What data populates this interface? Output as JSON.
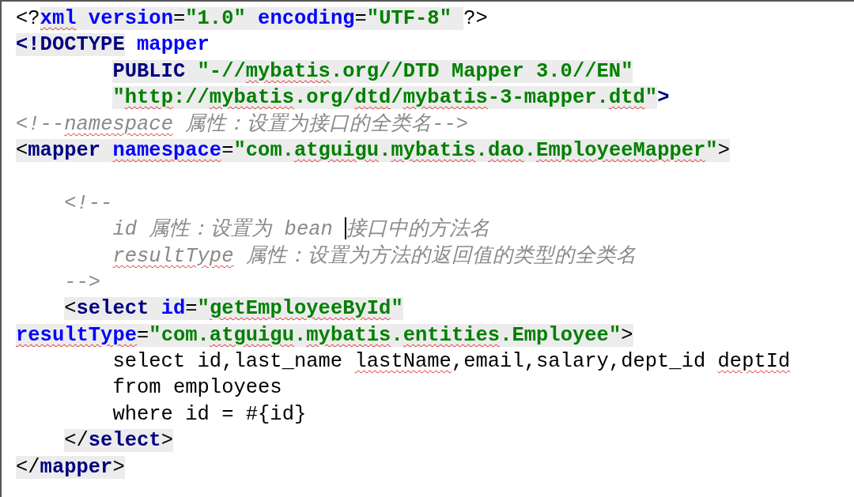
{
  "code_lines": [
    {
      "indented": false,
      "deep": false,
      "space_before": false,
      "tokens": [
        {
          "kind": "punct",
          "text": "<?",
          "shaded": false
        },
        {
          "kind": "attr",
          "text": "xml",
          "shaded": true,
          "misspelled": true
        },
        {
          "kind": "attr",
          "text": " version",
          "shaded": true
        },
        {
          "kind": "punct",
          "text": "=",
          "shaded": true
        },
        {
          "kind": "value",
          "text": "\"1.0\" ",
          "shaded": true
        },
        {
          "kind": "attr",
          "text": "encoding",
          "shaded": true
        },
        {
          "kind": "punct",
          "text": "=",
          "shaded": true
        },
        {
          "kind": "value",
          "text": "\"UTF-8\" ",
          "shaded": true
        },
        {
          "kind": "punct",
          "text": "?>",
          "shaded": false
        }
      ]
    },
    {
      "indented": false,
      "deep": false,
      "space_before": false,
      "tokens": [
        {
          "kind": "keyword",
          "text": "<!DOCTYPE",
          "shaded": true
        },
        {
          "kind": "attr",
          "text": " mapper",
          "shaded": false
        }
      ]
    },
    {
      "indented": true,
      "deep": true,
      "space_before": false,
      "tokens": [
        {
          "kind": "keyword",
          "text": "PUBLIC ",
          "shaded": true
        },
        {
          "kind": "value",
          "text": "\"-//",
          "shaded": true
        },
        {
          "kind": "value",
          "text": "mybatis",
          "shaded": true,
          "misspelled": true
        },
        {
          "kind": "value",
          "text": ".org//DTD Mapper 3.0//EN\"",
          "shaded": true
        }
      ]
    },
    {
      "indented": true,
      "deep": true,
      "space_before": false,
      "tokens": [
        {
          "kind": "value",
          "text": "\"",
          "shaded": true
        },
        {
          "kind": "value",
          "text": "http",
          "shaded": true,
          "misspelled": true
        },
        {
          "kind": "value",
          "text": "://",
          "shaded": true
        },
        {
          "kind": "value",
          "text": "mybatis",
          "shaded": true,
          "misspelled": true
        },
        {
          "kind": "value",
          "text": ".org/",
          "shaded": true
        },
        {
          "kind": "value",
          "text": "dtd",
          "shaded": true,
          "misspelled": true
        },
        {
          "kind": "value",
          "text": "/",
          "shaded": true
        },
        {
          "kind": "value",
          "text": "mybatis",
          "shaded": true,
          "misspelled": true
        },
        {
          "kind": "value",
          "text": "-3-mapper.",
          "shaded": true
        },
        {
          "kind": "value",
          "text": "dtd",
          "shaded": true,
          "misspelled": true
        },
        {
          "kind": "value",
          "text": "\"",
          "shaded": true
        },
        {
          "kind": "keyword",
          "text": ">",
          "shaded": false
        }
      ]
    },
    {
      "indented": false,
      "deep": false,
      "space_before": false,
      "tokens": [
        {
          "kind": "comment",
          "text": "<!--",
          "shaded": false
        },
        {
          "kind": "comment",
          "text": "namespace",
          "shaded": false,
          "misspelled": true
        },
        {
          "kind": "comment",
          "text": " 属性：设置为接口的全类名-->",
          "shaded": false
        }
      ]
    },
    {
      "indented": false,
      "deep": false,
      "space_before": false,
      "tokens": [
        {
          "kind": "punct",
          "text": "<",
          "shaded": true
        },
        {
          "kind": "keyword",
          "text": "mapper ",
          "shaded": true
        },
        {
          "kind": "attr",
          "text": "namespace",
          "shaded": true,
          "misspelled": true
        },
        {
          "kind": "punct",
          "text": "=",
          "shaded": true
        },
        {
          "kind": "value",
          "text": "\"com.",
          "shaded": true
        },
        {
          "kind": "value",
          "text": "atguigu",
          "shaded": true,
          "misspelled": true
        },
        {
          "kind": "value",
          "text": ".",
          "shaded": true
        },
        {
          "kind": "value",
          "text": "mybatis",
          "shaded": true,
          "misspelled": true
        },
        {
          "kind": "value",
          "text": ".",
          "shaded": true
        },
        {
          "kind": "value",
          "text": "dao",
          "shaded": true,
          "misspelled": true
        },
        {
          "kind": "value",
          "text": ".",
          "shaded": true
        },
        {
          "kind": "value",
          "text": "EmployeeMapper",
          "shaded": true,
          "misspelled": true
        },
        {
          "kind": "value",
          "text": "\"",
          "shaded": true
        },
        {
          "kind": "punct",
          "text": ">",
          "shaded": true
        }
      ]
    },
    {
      "indented": true,
      "deep": false,
      "space_before": true,
      "tokens": [
        {
          "kind": "comment",
          "text": "<!--",
          "shaded": false
        }
      ]
    },
    {
      "indented": true,
      "deep": true,
      "space_before": false,
      "tokens": [
        {
          "kind": "comment",
          "text": "id 属性：设置为 bean ",
          "shaded": false
        },
        {
          "kind": "caret"
        },
        {
          "kind": "comment",
          "text": "接口中的方法名",
          "shaded": false
        }
      ]
    },
    {
      "indented": true,
      "deep": true,
      "space_before": false,
      "tokens": [
        {
          "kind": "comment",
          "text": "resultType",
          "shaded": false,
          "misspelled": true
        },
        {
          "kind": "comment",
          "text": " 属性：设置为方法的返回值的类型的全类名",
          "shaded": false
        }
      ]
    },
    {
      "indented": true,
      "deep": false,
      "space_before": false,
      "tokens": [
        {
          "kind": "comment",
          "text": "-->",
          "shaded": false
        }
      ]
    },
    {
      "indented": true,
      "deep": false,
      "space_before": false,
      "tokens": [
        {
          "kind": "punct",
          "text": "<",
          "shaded": true
        },
        {
          "kind": "keyword",
          "text": "select ",
          "shaded": true
        },
        {
          "kind": "attr",
          "text": "id",
          "shaded": true
        },
        {
          "kind": "punct",
          "text": "=",
          "shaded": true
        },
        {
          "kind": "value",
          "text": "\"",
          "shaded": true
        },
        {
          "kind": "value",
          "text": "getEmployeeById",
          "shaded": true,
          "misspelled": true
        },
        {
          "kind": "value",
          "text": "\"",
          "shaded": true
        }
      ]
    },
    {
      "indented": false,
      "deep": false,
      "space_before": false,
      "tokens": [
        {
          "kind": "attr",
          "text": "resultType",
          "shaded": true,
          "misspelled": true
        },
        {
          "kind": "punct",
          "text": "=",
          "shaded": true
        },
        {
          "kind": "value",
          "text": "\"com.",
          "shaded": true
        },
        {
          "kind": "value",
          "text": "atguigu",
          "shaded": true,
          "misspelled": true
        },
        {
          "kind": "value",
          "text": ".",
          "shaded": true
        },
        {
          "kind": "value",
          "text": "mybatis",
          "shaded": true,
          "misspelled": true
        },
        {
          "kind": "value",
          "text": ".",
          "shaded": true
        },
        {
          "kind": "value",
          "text": "entities",
          "shaded": true,
          "misspelled": true
        },
        {
          "kind": "value",
          "text": ".Employee\"",
          "shaded": true
        },
        {
          "kind": "punct",
          "text": ">",
          "shaded": true
        }
      ]
    },
    {
      "indented": true,
      "deep": true,
      "space_before": false,
      "tokens": [
        {
          "kind": "text",
          "text": "select id,last_name ",
          "shaded": false
        },
        {
          "kind": "text",
          "text": "lastName",
          "shaded": false,
          "misspelled": true
        },
        {
          "kind": "text",
          "text": ",email,salary,dept_id ",
          "shaded": false
        },
        {
          "kind": "text",
          "text": "deptId",
          "shaded": false,
          "misspelled": true
        }
      ]
    },
    {
      "indented": true,
      "deep": true,
      "space_before": false,
      "tokens": [
        {
          "kind": "text",
          "text": "from employees",
          "shaded": false
        }
      ]
    },
    {
      "indented": true,
      "deep": true,
      "space_before": false,
      "tokens": [
        {
          "kind": "text",
          "text": "where id = #{id}",
          "shaded": false
        }
      ]
    },
    {
      "indented": true,
      "deep": false,
      "space_before": false,
      "tokens": [
        {
          "kind": "punct",
          "text": "</",
          "shaded": true
        },
        {
          "kind": "keyword",
          "text": "select",
          "shaded": true
        },
        {
          "kind": "punct",
          "text": ">",
          "shaded": true
        }
      ]
    },
    {
      "indented": false,
      "deep": false,
      "space_before": false,
      "tokens": [
        {
          "kind": "punct",
          "text": "</",
          "shaded": true
        },
        {
          "kind": "keyword",
          "text": "mapper",
          "shaded": true
        },
        {
          "kind": "punct",
          "text": ">",
          "shaded": true
        }
      ]
    }
  ]
}
